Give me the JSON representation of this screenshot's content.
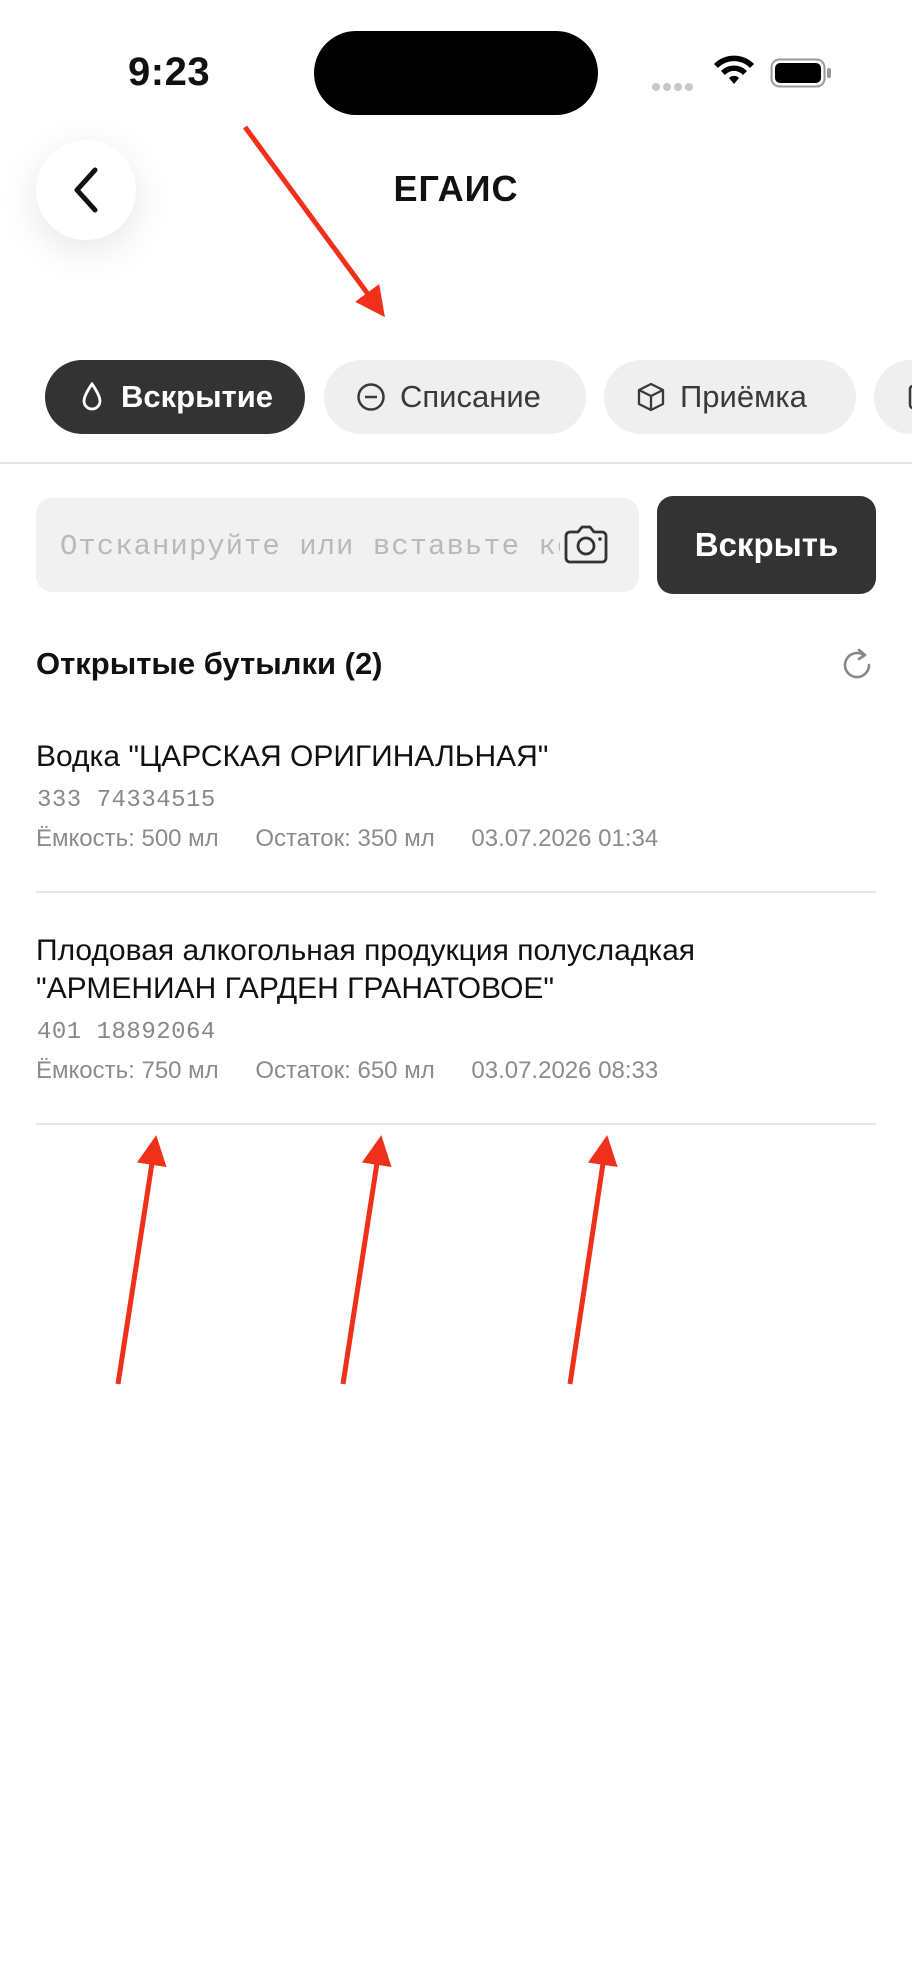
{
  "status_bar": {
    "time": "9:23"
  },
  "header": {
    "title": "ЕГАИС"
  },
  "tabs": [
    {
      "label": "Вскрытие",
      "icon": "drop-icon",
      "active": true
    },
    {
      "label": "Списание",
      "icon": "minus-circle-icon",
      "active": false
    },
    {
      "label": "Приёмка",
      "icon": "box-icon",
      "active": false
    }
  ],
  "scan": {
    "placeholder": "Отсканируйте или вставьте код",
    "button_label": "Вскрыть"
  },
  "section": {
    "title": "Открытые бутылки (2)"
  },
  "bottles": [
    {
      "title_lines": [
        "Водка \"ЦАРСКАЯ ОРИГИНАЛЬНАЯ\""
      ],
      "code": "333  74334515",
      "capacity": "Ёмкость: 500 мл",
      "remaining": "Остаток: 350 мл",
      "datetime": "03.07.2026 01:34"
    },
    {
      "title_lines": [
        "Плодовая алкогольная продукция полусладкая",
        "\"АРМЕНИАН ГАРДЕН ГРАНАТОВОЕ\""
      ],
      "code": "401  18892064",
      "capacity": "Ёмкость: 750 мл",
      "remaining": "Остаток: 650 мл",
      "datetime": "03.07.2026 08:33"
    }
  ],
  "colors": {
    "accent_dark": "#333333",
    "annotation_arrow": "#f0301a",
    "chip_bg": "#efefef"
  }
}
